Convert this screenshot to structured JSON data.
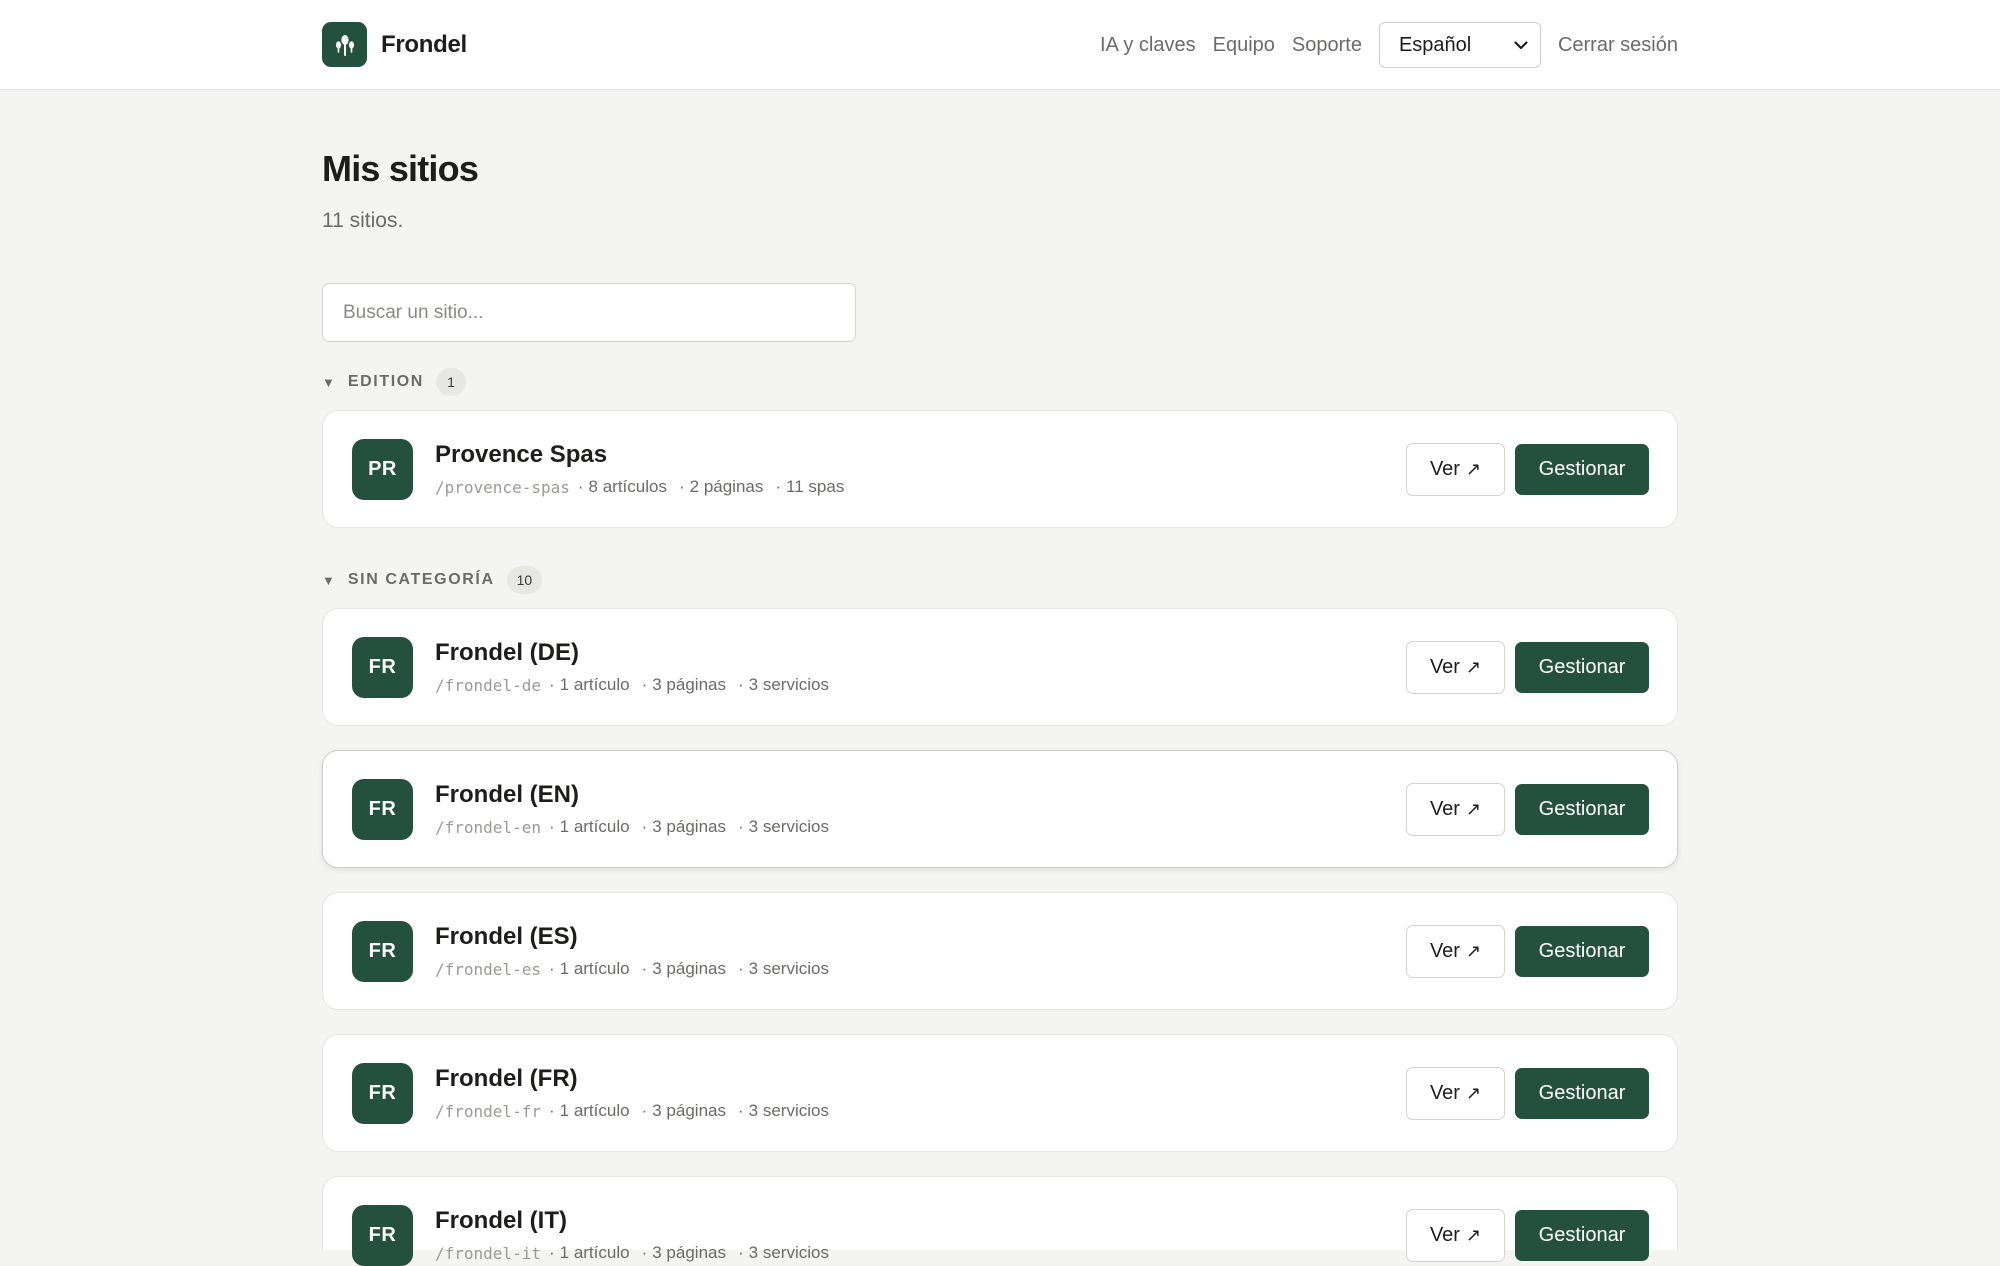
{
  "header": {
    "brand": "Frondel",
    "nav": [
      "IA y claves",
      "Equipo",
      "Soporte"
    ],
    "language": "Español",
    "logout": "Cerrar sesión"
  },
  "page": {
    "title": "Mis sitios",
    "subtitle": "11 sitios."
  },
  "search": {
    "placeholder": "Buscar un sitio..."
  },
  "groups": [
    {
      "label": "EDITION",
      "count": "1",
      "sites": [
        {
          "initials": "PR",
          "name": "Provence Spas",
          "slug": "/provence-spas",
          "meta": [
            "8 artículos",
            "2 páginas",
            "11 spas"
          ]
        }
      ]
    },
    {
      "label": "SIN CATEGORÍA",
      "count": "10",
      "sites": [
        {
          "initials": "FR",
          "name": "Frondel (DE)",
          "slug": "/frondel-de",
          "meta": [
            "1 artículo",
            "3 páginas",
            "3 servicios"
          ]
        },
        {
          "initials": "FR",
          "name": "Frondel (EN)",
          "slug": "/frondel-en",
          "meta": [
            "1 artículo",
            "3 páginas",
            "3 servicios"
          ]
        },
        {
          "initials": "FR",
          "name": "Frondel (ES)",
          "slug": "/frondel-es",
          "meta": [
            "1 artículo",
            "3 páginas",
            "3 servicios"
          ]
        },
        {
          "initials": "FR",
          "name": "Frondel (FR)",
          "slug": "/frondel-fr",
          "meta": [
            "1 artículo",
            "3 páginas",
            "3 servicios"
          ]
        },
        {
          "initials": "FR",
          "name": "Frondel (IT)",
          "slug": "/frondel-it",
          "meta": [
            "1 artículo",
            "3 páginas",
            "3 servicios"
          ]
        }
      ]
    }
  ],
  "buttons": {
    "view": "Ver",
    "view_icon": "↗",
    "manage": "Gestionar"
  }
}
